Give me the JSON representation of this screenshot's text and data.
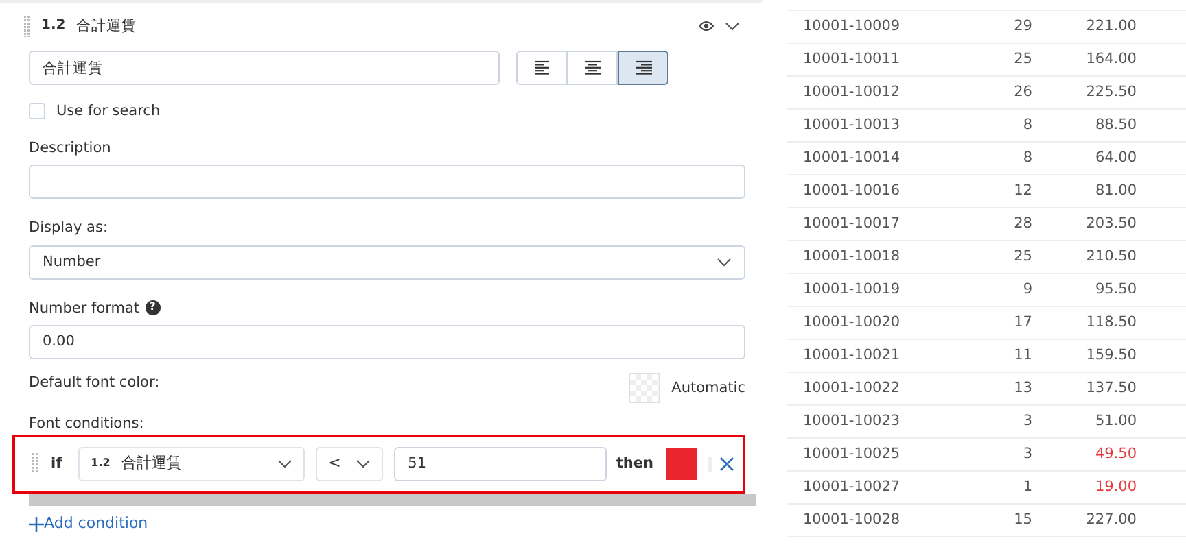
{
  "field": {
    "number": "1.2",
    "title": "合計運賃",
    "visible": true,
    "expanded": true
  },
  "name_input": {
    "value": "合計運賃"
  },
  "alignment": [
    {
      "kind": "left",
      "selected": false
    },
    {
      "kind": "center",
      "selected": false
    },
    {
      "kind": "right",
      "selected": true
    }
  ],
  "use_for_search": {
    "label": "Use for search",
    "checked": false
  },
  "description": {
    "label": "Description"
  },
  "display_as": {
    "label": "Display as:",
    "value": "Number"
  },
  "number_format": {
    "label": "Number format",
    "help": "?",
    "value": "0.00"
  },
  "default_font_color": {
    "label": "Default font color:",
    "value": "Automatic"
  },
  "font_conditions": {
    "label": "Font conditions:",
    "conditions": [
      {
        "if": "if",
        "field_number": "1.2",
        "field": "合計運賃",
        "operator": "<",
        "value": "51",
        "then": "then",
        "color": "#e8262b"
      }
    ],
    "add_label": "Add condition"
  },
  "table": {
    "rows": [
      {
        "id": "10001-10009",
        "qty": "29",
        "amount": "221.00",
        "color": "#555555"
      },
      {
        "id": "10001-10011",
        "qty": "25",
        "amount": "164.00",
        "color": "#555555"
      },
      {
        "id": "10001-10012",
        "qty": "26",
        "amount": "225.50",
        "color": "#555555"
      },
      {
        "id": "10001-10013",
        "qty": "8",
        "amount": "88.50",
        "color": "#555555"
      },
      {
        "id": "10001-10014",
        "qty": "8",
        "amount": "64.00",
        "color": "#555555"
      },
      {
        "id": "10001-10016",
        "qty": "12",
        "amount": "81.00",
        "color": "#555555"
      },
      {
        "id": "10001-10017",
        "qty": "28",
        "amount": "203.50",
        "color": "#555555"
      },
      {
        "id": "10001-10018",
        "qty": "25",
        "amount": "210.50",
        "color": "#555555"
      },
      {
        "id": "10001-10019",
        "qty": "9",
        "amount": "95.50",
        "color": "#555555"
      },
      {
        "id": "10001-10020",
        "qty": "17",
        "amount": "118.50",
        "color": "#555555"
      },
      {
        "id": "10001-10021",
        "qty": "11",
        "amount": "159.50",
        "color": "#555555"
      },
      {
        "id": "10001-10022",
        "qty": "13",
        "amount": "137.50",
        "color": "#555555"
      },
      {
        "id": "10001-10023",
        "qty": "3",
        "amount": "51.00",
        "color": "#555555"
      },
      {
        "id": "10001-10025",
        "qty": "3",
        "amount": "49.50",
        "color": "#e8383d"
      },
      {
        "id": "10001-10027",
        "qty": "1",
        "amount": "19.00",
        "color": "#e8383d"
      },
      {
        "id": "10001-10028",
        "qty": "15",
        "amount": "227.00",
        "color": "#555555"
      }
    ]
  }
}
